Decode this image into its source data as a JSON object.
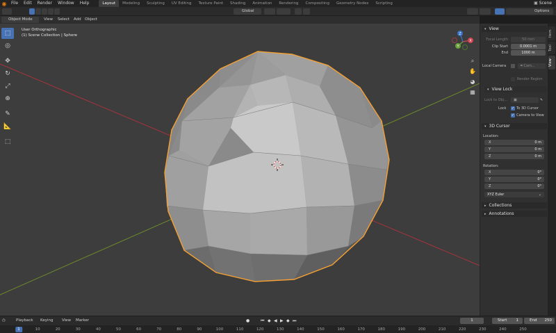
{
  "topbar": {
    "menus": [
      "File",
      "Edit",
      "Render",
      "Window",
      "Help"
    ],
    "workspaces": [
      "Layout",
      "Modeling",
      "Sculpting",
      "UV Editing",
      "Texture Paint",
      "Shading",
      "Animation",
      "Rendering",
      "Compositing",
      "Geometry Nodes",
      "Scripting"
    ],
    "active_workspace": "Layout",
    "scene_label": "Scene"
  },
  "header": {
    "transform_orientation": "Global",
    "options_label": "Options"
  },
  "viewport_header": {
    "mode": "Object Mode",
    "menus": [
      "View",
      "Select",
      "Add",
      "Object"
    ]
  },
  "viewport": {
    "view_name": "User Orthographic",
    "collection_info": "(1) Scene Collection | Sphere",
    "gizmo_axes": [
      "X",
      "Y",
      "Z"
    ],
    "colors": {
      "background": "#3d3d3d",
      "selection_outline": "#f5a033",
      "x_axis": "#a8333c",
      "y_axis": "#6c8a2a",
      "active_tool": "#4772b3"
    }
  },
  "toolbar": {
    "tools": [
      "select-box-icon",
      "cursor-icon",
      "move-icon",
      "rotate-icon",
      "scale-icon",
      "transform-icon",
      "annotate-icon",
      "measure-icon",
      "add-cube-icon"
    ]
  },
  "sidebar": {
    "tabs": [
      "Item",
      "Tool",
      "View"
    ],
    "active_tab": "View",
    "view_panel": {
      "title": "View",
      "focal_length_label": "Focal Length",
      "focal_length_value": "50 mm",
      "clip_start_label": "Clip Start",
      "clip_start_value": "0.0001 m",
      "end_label": "End",
      "end_value": "1000 m",
      "local_camera_label": "Local Camera",
      "local_camera_value": "Cam...",
      "render_region_label": "Render Region"
    },
    "view_lock_panel": {
      "title": "View Lock",
      "lock_to_object_label": "Lock to Obj...",
      "lock_label": "Lock",
      "to_3d_cursor_label": "To 3D Cursor",
      "camera_to_view_label": "Camera to View"
    },
    "cursor_panel": {
      "title": "3D Cursor",
      "location_label": "Location:",
      "location": [
        {
          "axis": "X",
          "value": "0 m"
        },
        {
          "axis": "Y",
          "value": "0 m"
        },
        {
          "axis": "Z",
          "value": "0 m"
        }
      ],
      "rotation_label": "Rotation:",
      "rotation": [
        {
          "axis": "X",
          "value": "0°"
        },
        {
          "axis": "Y",
          "value": "0°"
        },
        {
          "axis": "Z",
          "value": "0°"
        }
      ],
      "rotation_mode": "XYZ Euler"
    },
    "collections_title": "Collections",
    "annotations_title": "Annotations"
  },
  "timeline": {
    "menus": [
      "Playback",
      "Keying",
      "View",
      "Marker"
    ],
    "current_frame": "1",
    "start_label": "Start",
    "start_value": "1",
    "end_label": "End",
    "end_value": "250",
    "ruler_ticks": [
      "1",
      "10",
      "20",
      "30",
      "40",
      "50",
      "60",
      "70",
      "80",
      "90",
      "100",
      "110",
      "120",
      "130",
      "140",
      "150",
      "160",
      "170",
      "180",
      "190",
      "200",
      "210",
      "220",
      "230",
      "240",
      "250"
    ]
  }
}
